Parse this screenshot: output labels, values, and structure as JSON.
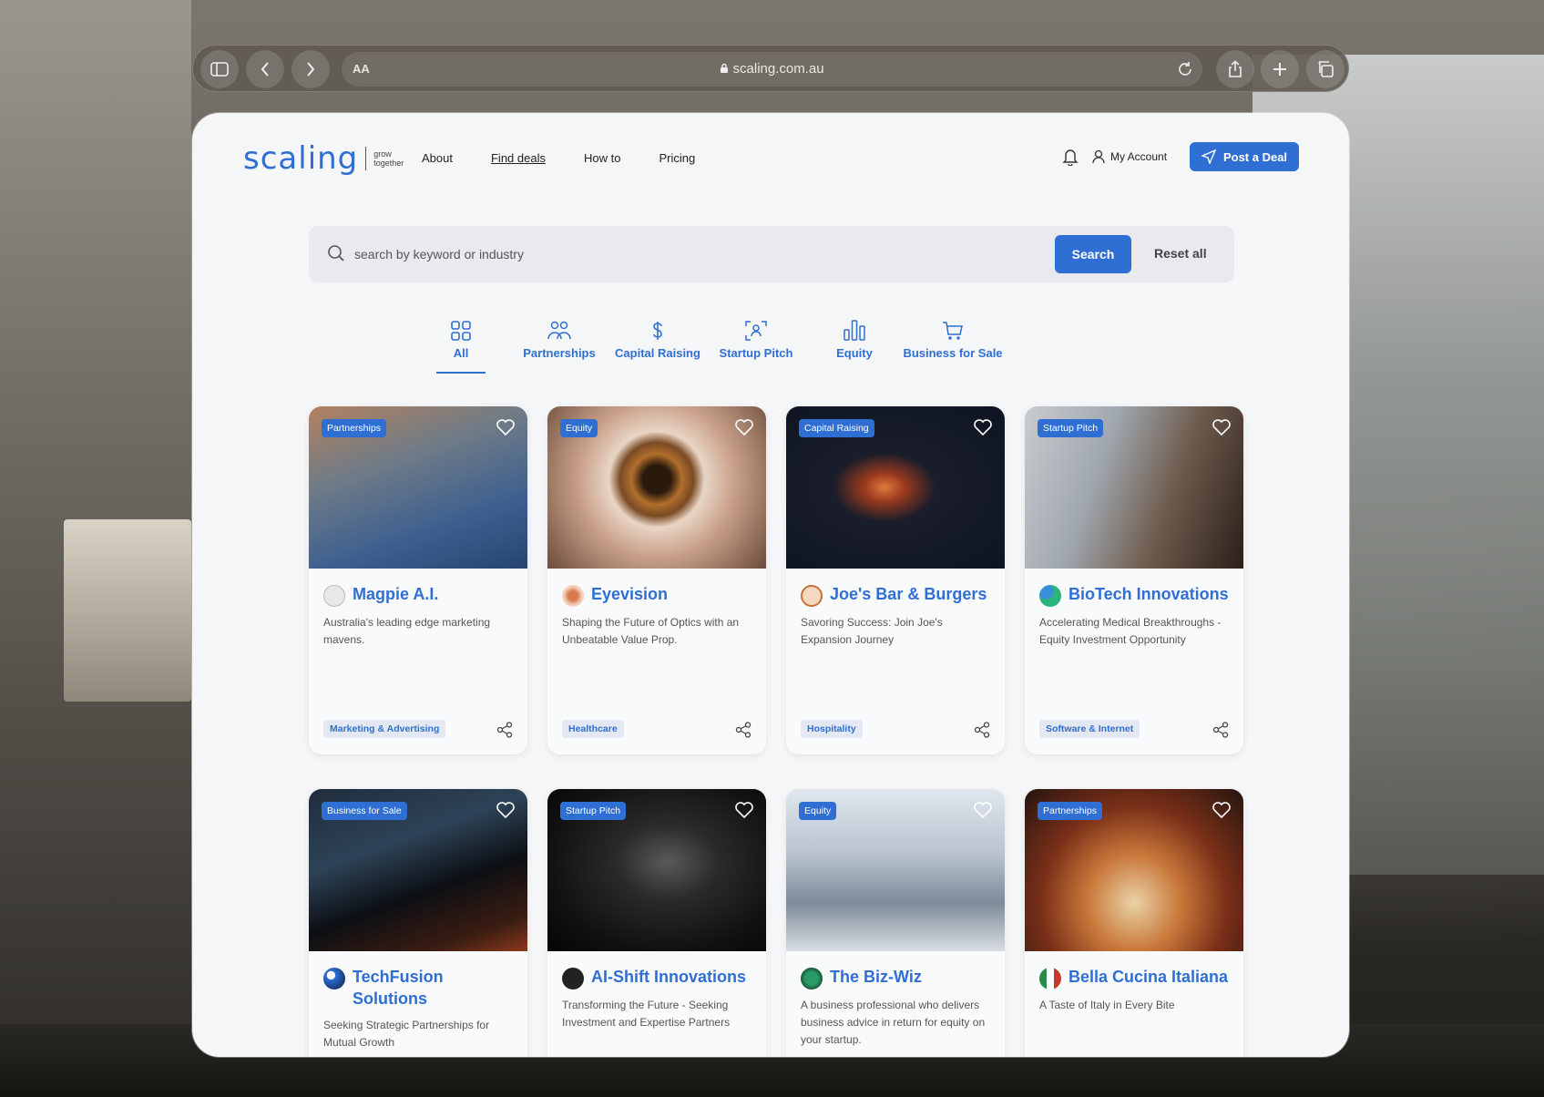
{
  "browser": {
    "text_size_label": "AA",
    "url": "scaling.com.au"
  },
  "header": {
    "logo": "scaling",
    "tagline_1": "grow",
    "tagline_2": "together",
    "nav": [
      "About",
      "Find deals",
      "How to",
      "Pricing"
    ],
    "account_label": "My Account",
    "post_label": "Post a Deal"
  },
  "search": {
    "placeholder": "search by keyword or industry",
    "button": "Search",
    "reset": "Reset all"
  },
  "categories": [
    {
      "label": "All",
      "icon": "grid-icon"
    },
    {
      "label": "Partnerships",
      "icon": "people-icon"
    },
    {
      "label": "Capital Raising",
      "icon": "dollar-icon"
    },
    {
      "label": "Startup Pitch",
      "icon": "pitch-icon"
    },
    {
      "label": "Equity",
      "icon": "bar-chart-icon"
    },
    {
      "label": "Business for Sale",
      "icon": "cart-icon"
    }
  ],
  "active_category": "All",
  "deals": [
    {
      "badge": "Partnerships",
      "title": "Magpie A.I.",
      "desc": "Australia's leading edge marketing mavens.",
      "tag": "Marketing & Advertising"
    },
    {
      "badge": "Equity",
      "title": "Eyevision",
      "desc": "Shaping the Future of Optics with an Unbeatable Value Prop.",
      "tag": "Healthcare"
    },
    {
      "badge": "Capital Raising",
      "title": "Joe's Bar & Burgers",
      "desc": "Savoring Success: Join Joe's Expansion Journey",
      "tag": "Hospitality"
    },
    {
      "badge": "Startup Pitch",
      "title": "BioTech Innovations",
      "desc": "Accelerating Medical Breakthroughs - Equity Investment Opportunity",
      "tag": "Software & Internet"
    },
    {
      "badge": "Business for Sale",
      "title": "TechFusion Solutions",
      "desc": "Seeking Strategic Partnerships for Mutual Growth",
      "tag": ""
    },
    {
      "badge": "Startup Pitch",
      "title": "AI-Shift Innovations",
      "desc": "Transforming the Future - Seeking Investment and Expertise Partners",
      "tag": ""
    },
    {
      "badge": "Equity",
      "title": "The Biz-Wiz",
      "desc": "A business professional who delivers business advice in return for equity on your startup.",
      "tag": ""
    },
    {
      "badge": "Partnerships",
      "title": "Bella Cucina Italiana",
      "desc": "A Taste of Italy in Every Bite",
      "tag": ""
    }
  ],
  "colors": {
    "accent": "#2f6fd4",
    "page": "#f5f6f8"
  }
}
